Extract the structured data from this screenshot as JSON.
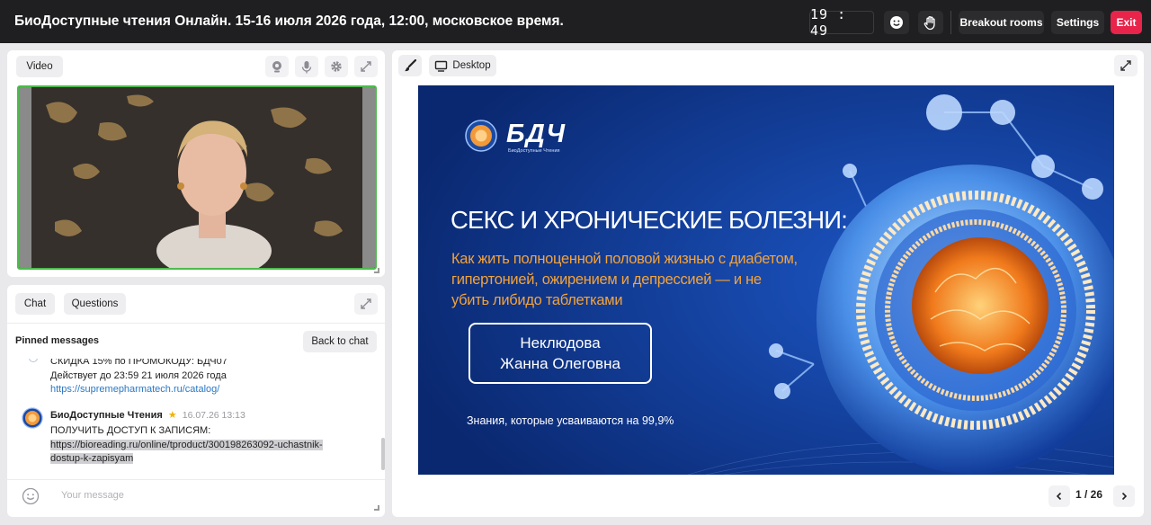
{
  "header": {
    "title": "БиоДоступные чтения Онлайн. 15-16 июля 2026 года, 12:00, московское время.",
    "clock": "19 : 49",
    "breakout_label": "Breakout rooms",
    "settings_label": "Settings",
    "exit_label": "Exit"
  },
  "video_panel": {
    "tab_label": "Video"
  },
  "chat_panel": {
    "tabs": [
      "Chat",
      "Questions"
    ],
    "pinned_label": "Pinned messages",
    "back_label": "Back to chat",
    "messages": [
      {
        "lines": [
          "СКИДКА 15% по ПРОМОКОДУ: БДЧ07",
          "Действует до 23:59 21 июля 2026 года"
        ],
        "link": "https://supremepharmatech.ru/catalog/"
      },
      {
        "author": "БиоДоступные Чтения",
        "time": "16.07.26 13:13",
        "text": "ПОЛУЧИТЬ ДОСТУП К ЗАПИСЯМ:",
        "link_line1": "https://bioreading.ru/online/tproduct/300198263092-uchastnik-",
        "link_line2": "dostup-k-zapisyam"
      }
    ],
    "input_placeholder": "Your message"
  },
  "presentation": {
    "tab_label": "Desktop",
    "slide": {
      "logo_text": "БДЧ",
      "logo_sub": "БиоДоступные Чтения",
      "heading": "СЕКС И ХРОНИЧЕСКИЕ БОЛЕЗНИ:",
      "sub_line1": "Как жить полноценной половой жизнью с диабетом,",
      "sub_line2": "гипертонией, ожирением и депрессией — и не",
      "sub_line3": "убить либидо таблетками",
      "speaker_line1": "Неклюдова",
      "speaker_line2": "Жанна Олеговна",
      "footer": "Знания, которые усваиваются на 99,9%"
    },
    "page_indicator": "1 / 26"
  },
  "colors": {
    "topbar": "#1f1f21",
    "exit": "#e8244a",
    "video_border": "#4cbb4c",
    "slide_bg": "#0c2f80",
    "slide_accent": "#f3a33a",
    "link": "#2a78c5"
  }
}
